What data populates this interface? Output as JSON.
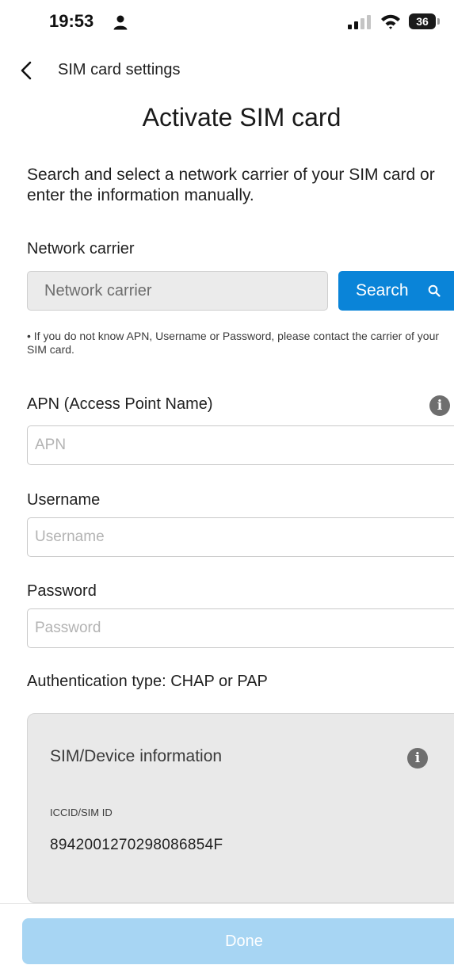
{
  "status_bar": {
    "time": "19:53",
    "battery_level": "36",
    "icons": [
      "person-icon",
      "cellular-signal-icon",
      "wifi-icon",
      "battery-icon"
    ]
  },
  "header": {
    "back_icon": "chevron-left-icon",
    "nav_title": "SIM card settings",
    "page_title": "Activate SIM card"
  },
  "intro": "Search and select a network carrier of your SIM card or enter the information manually.",
  "carrier": {
    "label": "Network carrier",
    "placeholder": "Network carrier",
    "value": "",
    "search_label": "Search",
    "search_icon": "magnifier-icon",
    "search_color": "#0a84d8"
  },
  "note": "• If you do not know APN, Username or Password, please contact the carrier of your SIM card.",
  "apn": {
    "label": "APN (Access Point Name)",
    "placeholder": "APN",
    "value": "",
    "info_icon": "info-icon",
    "info_glyph": "i"
  },
  "username": {
    "label": "Username",
    "placeholder": "Username",
    "value": ""
  },
  "password": {
    "label": "Password",
    "placeholder": "Password",
    "value": ""
  },
  "auth_type": "Authentication type: CHAP or PAP",
  "device_info": {
    "title": "SIM/Device information",
    "info_icon": "info-icon",
    "info_glyph": "i",
    "iccid_label": "ICCID/SIM ID",
    "iccid_value": "8942001270298086854F"
  },
  "footer": {
    "done_label": "Done",
    "done_color": "#a7d5f3"
  }
}
